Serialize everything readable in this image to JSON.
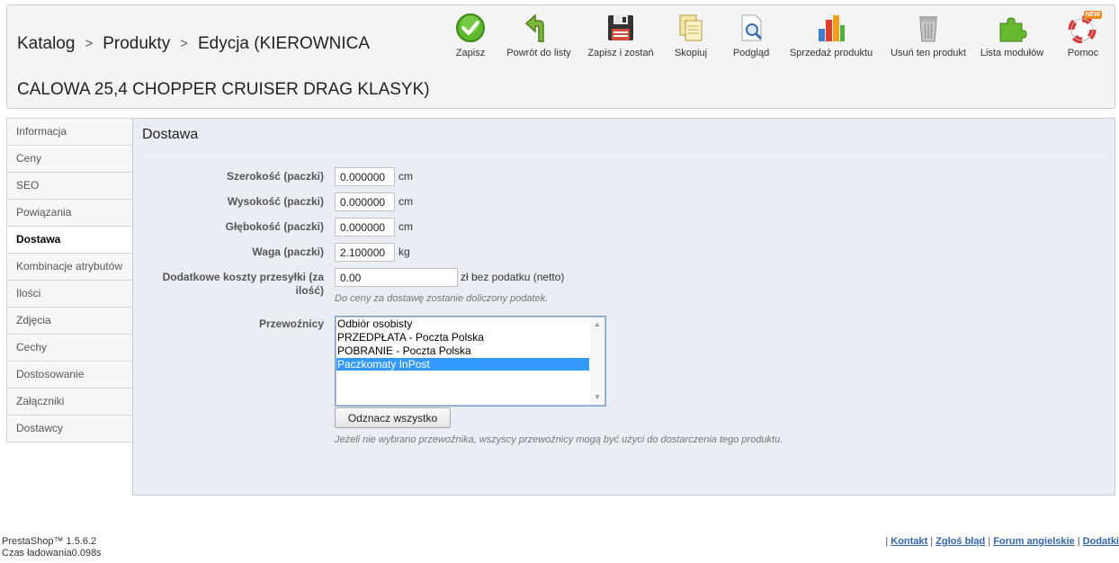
{
  "header": {
    "breadcrumb": {
      "item1": "Katalog",
      "item2": "Produkty",
      "item3": "Edycja (KIEROWNICA CALOWA 25,4 CHOPPER CRUISER DRAG KLASYK)",
      "separator": ">"
    },
    "toolbar": [
      {
        "label": "Zapisz",
        "icon": "save-check-icon"
      },
      {
        "label": "Powrót do listy",
        "icon": "back-arrow-icon"
      },
      {
        "label": "Zapisz i zostań",
        "icon": "floppy-disk-icon"
      },
      {
        "label": "Skopiuj",
        "icon": "copy-icon"
      },
      {
        "label": "Podgląd",
        "icon": "preview-magnifier-icon"
      },
      {
        "label": "Sprzedaż produktu",
        "icon": "bar-chart-icon"
      },
      {
        "label": "Usuń ten produkt",
        "icon": "trash-bin-icon"
      },
      {
        "label": "Lista modułów",
        "icon": "puzzle-icon"
      },
      {
        "label": "Pomoc",
        "icon": "lifebuoy-icon",
        "badge": "NEW"
      }
    ]
  },
  "sidebar": {
    "items": [
      {
        "label": "Informacja"
      },
      {
        "label": "Ceny"
      },
      {
        "label": "SEO"
      },
      {
        "label": "Powiązania"
      },
      {
        "label": "Dostawa",
        "active": true
      },
      {
        "label": "Kombinacje atrybutów"
      },
      {
        "label": "Ilości"
      },
      {
        "label": "Zdjęcia"
      },
      {
        "label": "Cechy"
      },
      {
        "label": "Dostosowanie"
      },
      {
        "label": "Załączniki"
      },
      {
        "label": "Dostawcy"
      }
    ]
  },
  "panel": {
    "title": "Dostawa",
    "width": {
      "label": "Szerokość (paczki)",
      "value": "0.000000",
      "unit": "cm"
    },
    "height": {
      "label": "Wysokość (paczki)",
      "value": "0.000000",
      "unit": "cm"
    },
    "depth": {
      "label": "Głębokość (paczki)",
      "value": "0.000000",
      "unit": "cm"
    },
    "weight": {
      "label": "Waga (paczki)",
      "value": "2.100000",
      "unit": "kg"
    },
    "extra_cost": {
      "label": "Dodatkowe koszty przesyłki (za ilość)",
      "value": "0.00",
      "unit": "zł bez podatku (netto)",
      "hint": "Do ceny za dostawę zostanie doliczony podatek."
    },
    "carriers": {
      "label": "Przewoźnicy",
      "options": [
        {
          "label": "Odbiór osobisty",
          "selected": false
        },
        {
          "label": "PRZEDPŁATA - Poczta Polska",
          "selected": false
        },
        {
          "label": "POBRANIE - Poczta Polska",
          "selected": false
        },
        {
          "label": "Paczkomaty InPost",
          "selected": true
        }
      ],
      "unselect_button": "Odznacz wszystko",
      "hint": "Jeżeli nie wybrano przewoźnika, wszyscy przewoźnicy mogą być użyci do dostarczenia tego produktu."
    }
  },
  "footer": {
    "version": "PrestaShop™ 1.5.6.2",
    "load_time": "Czas ładowania0.098s",
    "links": [
      "Kontakt",
      "Zgłoś błąd",
      "Forum angielskie",
      "Dodatki"
    ],
    "separator": "|"
  },
  "colors": {
    "panel_bg": "#ebedf4",
    "selected_option": "#3399ff",
    "link": "#3366aa"
  }
}
